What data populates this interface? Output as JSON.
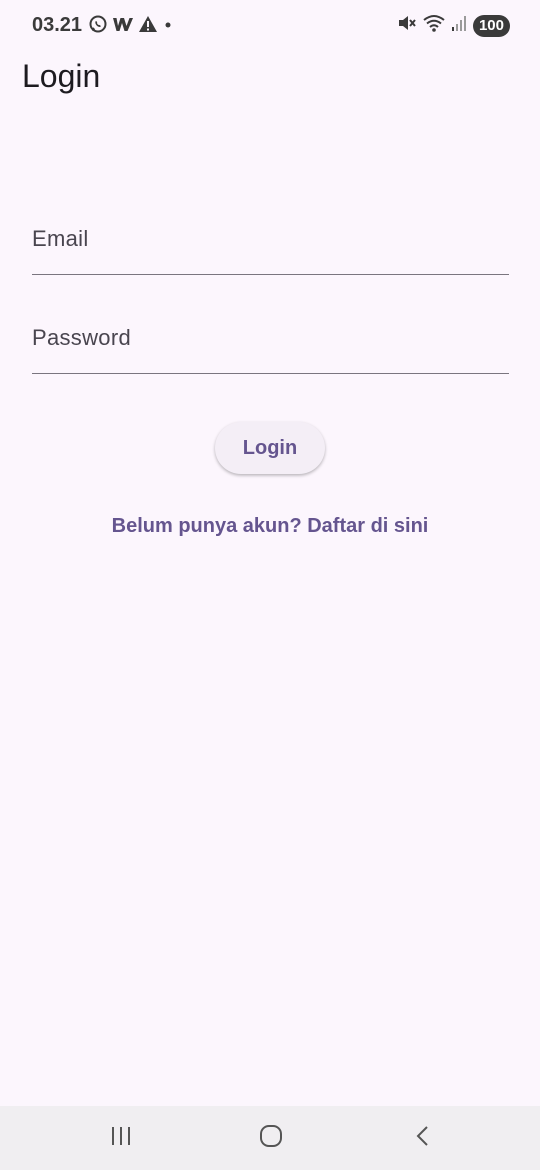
{
  "status_bar": {
    "time": "03.21",
    "battery": "100",
    "icons": [
      "whatsapp-icon",
      "w-app-icon",
      "warning-icon",
      "dot-icon",
      "mute-icon",
      "wifi-icon",
      "signal-icon"
    ]
  },
  "app_bar": {
    "title": "Login"
  },
  "form": {
    "email_placeholder": "Email",
    "email_value": "",
    "password_placeholder": "Password",
    "password_value": "",
    "login_label": "Login",
    "register_link": "Belum punya akun? Daftar di sini"
  },
  "nav_bar": {
    "icons": [
      "recents-icon",
      "home-icon",
      "back-icon"
    ]
  },
  "colors": {
    "background": "#fcf6fd",
    "accent": "#65558f",
    "button_background": "#f4eef6",
    "nav_background": "#f0eef1"
  }
}
